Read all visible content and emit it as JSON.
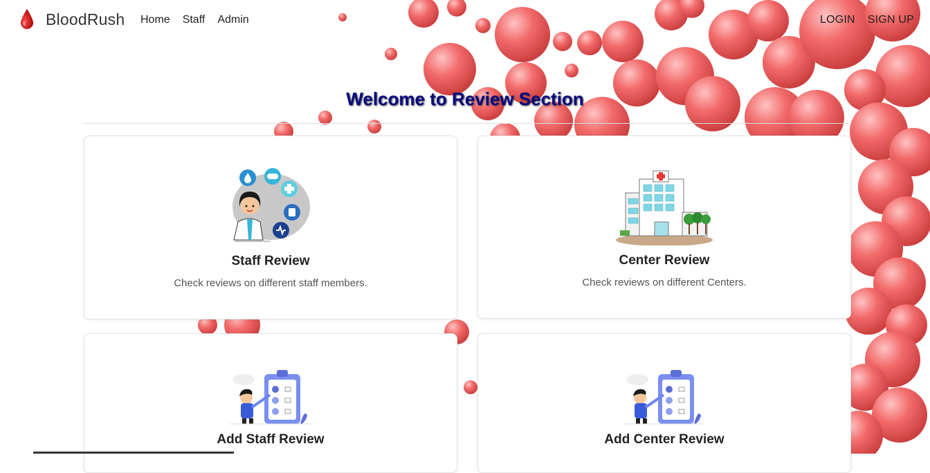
{
  "brand": {
    "name": "BloodRush",
    "icon": "blood-drop-icon"
  },
  "nav": {
    "links": [
      "Home",
      "Staff",
      "Admin"
    ]
  },
  "auth": {
    "login": "LOGIN",
    "signup": "SIGN UP"
  },
  "page": {
    "heading": "Welcome to Review Section"
  },
  "cards": [
    {
      "title": "Staff Review",
      "description": "Check reviews on different staff members.",
      "icon": "doctor-illustration"
    },
    {
      "title": "Center Review",
      "description": "Check reviews on different Centers.",
      "icon": "hospital-illustration"
    },
    {
      "title": "Add Staff Review",
      "icon": "feedback-clipboard-illustration"
    },
    {
      "title": "Add Center Review",
      "icon": "feedback-clipboard-illustration"
    }
  ],
  "colors": {
    "accent": "#0a0a80",
    "blood": "#e53935",
    "background_cells": "#f26a6a"
  }
}
